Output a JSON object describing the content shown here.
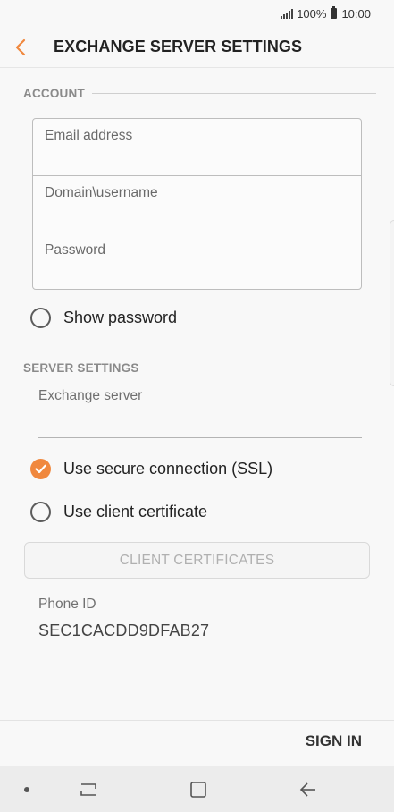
{
  "status_bar": {
    "battery_percent": "100%",
    "time": "10:00"
  },
  "header": {
    "title": "EXCHANGE SERVER SETTINGS"
  },
  "account_section": {
    "label": "ACCOUNT",
    "fields": [
      {
        "placeholder": "Email address",
        "value": ""
      },
      {
        "placeholder": "Domain\\username",
        "value": ""
      },
      {
        "placeholder": "Password",
        "value": ""
      }
    ],
    "show_password": {
      "label": "Show password",
      "checked": false
    }
  },
  "server_section": {
    "label": "SERVER SETTINGS",
    "exchange_server": {
      "label": "Exchange server",
      "value": ""
    },
    "use_ssl": {
      "label": "Use secure connection (SSL)",
      "checked": true
    },
    "use_client_certificate": {
      "label": "Use client certificate",
      "checked": false
    },
    "client_certificates_button": "CLIENT CERTIFICATES",
    "phone_id": {
      "label": "Phone ID",
      "value": "SEC1CACDD9DFAB27"
    }
  },
  "actions": {
    "sign_in": "SIGN IN"
  },
  "colors": {
    "accent": "#f0883e",
    "background": "#f8f8f8",
    "nav_bar": "#ececec"
  }
}
